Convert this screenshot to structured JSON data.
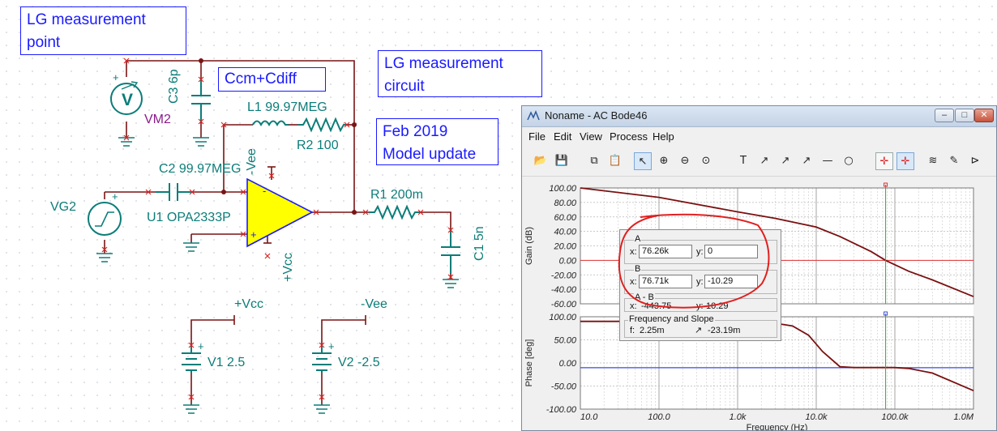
{
  "schematic": {
    "notes": {
      "lg_point": "LG measurement\npoint",
      "lg_circuit": "LG measurement\ncircuit",
      "model_update": "Feb 2019\nModel update",
      "ccm": "Ccm+Cdiff"
    },
    "labels": {
      "c3": "C3 6p",
      "vm2": "VM2",
      "l1": "L1 99.97MEG",
      "r2": "R2 100",
      "c2": "C2 99.97MEG",
      "vee_pin": "-Vee",
      "vg2": "VG2",
      "u1": "U1 OPA2333P",
      "vcc_pin": "+Vcc",
      "r1": "R1 200m",
      "c1": "C1 5n",
      "vcc_label": "+Vcc",
      "vee_label": "-Vee",
      "v1": "V1 2.5",
      "v2": "V2 -2.5",
      "plus": "+",
      "minus": "-",
      "meter_v": "V"
    },
    "colors": {
      "wire": "#7a1414",
      "component": "#0b7d78",
      "opamp_fill": "#ffff00",
      "opamp_stroke": "#1a1aff",
      "meter_label": "#8b1a8b",
      "note": "#1a1aff"
    }
  },
  "bode_window": {
    "title": "Noname - AC Bode46",
    "window_buttons": [
      "–",
      "□",
      "✕"
    ],
    "menu": [
      "File",
      "Edit",
      "View",
      "Process",
      "Help"
    ],
    "toolbar_icons": [
      {
        "name": "open-icon",
        "glyph": "📂"
      },
      {
        "name": "save-icon",
        "glyph": "💾"
      },
      {
        "name": "copy-icon",
        "glyph": "⧉"
      },
      {
        "name": "paste-icon",
        "glyph": "📋"
      },
      {
        "name": "pointer-icon",
        "glyph": "↖"
      },
      {
        "name": "zoom-in-icon",
        "glyph": "⊕"
      },
      {
        "name": "zoom-out-icon",
        "glyph": "⊖"
      },
      {
        "name": "zoom-fit-icon",
        "glyph": "⊙"
      },
      {
        "name": "text-icon",
        "glyph": "T"
      },
      {
        "name": "curve-label-icon",
        "glyph": "↗"
      },
      {
        "name": "curve-label-2-icon",
        "glyph": "↗"
      },
      {
        "name": "curve-label-3-icon",
        "glyph": "↗"
      },
      {
        "name": "line-icon",
        "glyph": "—"
      },
      {
        "name": "circle-icon",
        "glyph": "○"
      },
      {
        "name": "cursor-a-icon",
        "glyph": "✛"
      },
      {
        "name": "cursor-b-icon",
        "glyph": "✛"
      },
      {
        "name": "waves-icon",
        "glyph": "≋"
      },
      {
        "name": "probe-icon",
        "glyph": "✎"
      },
      {
        "name": "flag-icon",
        "glyph": "⊳"
      }
    ],
    "chart_data": {
      "type": "line",
      "xlabel": "Frequency (Hz)",
      "x_scale": "log",
      "x_ticks": [
        "10.0",
        "100.0",
        "1.0k",
        "10.0k",
        "100.0k",
        "1.0M"
      ],
      "xlim": [
        10,
        1000000
      ],
      "gain": {
        "ylabel": "Gain (dB)",
        "ylim": [
          -60,
          100
        ],
        "y_ticks": [
          "100.00",
          "80.00",
          "60.00",
          "40.00",
          "20.00",
          "0.00",
          "-20.00",
          "-40.00",
          "-60.00"
        ],
        "series": [
          {
            "x": [
              10,
              100,
              1000,
              3000,
              10000,
              20000,
              50000,
              76260,
              150000,
              300000,
              1000000
            ],
            "y": [
              100,
              87,
              67,
              58,
              46,
              33,
              12,
              0,
              -15,
              -27,
              -50
            ]
          }
        ]
      },
      "phase": {
        "ylabel": "Phase [deg]",
        "ylim": [
          -100,
          100
        ],
        "y_ticks": [
          "100.00",
          "50.00",
          "0.00",
          "-50.00",
          "-100.00"
        ],
        "reference_line": -10.29,
        "series": [
          {
            "x": [
              10,
              100,
              1000,
              1500,
              3000,
              5000,
              8000,
              12000,
              20000,
              30000,
              60000,
              100000,
              150000,
              300000,
              1000000
            ],
            "y": [
              90,
              90,
              90,
              89,
              86,
              80,
              60,
              25,
              -8,
              -10,
              -10,
              -10,
              -12,
              -22,
              -60
            ]
          }
        ]
      },
      "cursor_x": 76260
    },
    "cursors": {
      "a_label": "A",
      "a_x_label": "x:",
      "a_x": "76.26k",
      "a_y_label": "y:",
      "a_y": "0",
      "b_label": "B",
      "b_x_label": "x:",
      "b_x": "76.71k",
      "b_y_label": "y:",
      "b_y": "-10.29",
      "ab_label": "A - B",
      "ab_x_label": "x:",
      "ab_x": "-443.75",
      "ab_y_label": "y:",
      "ab_y": "10.29",
      "fs_label": "Frequency and Slope",
      "f_label": "f:",
      "f_value": "2.25m",
      "slope_value": "-23.19m"
    }
  }
}
